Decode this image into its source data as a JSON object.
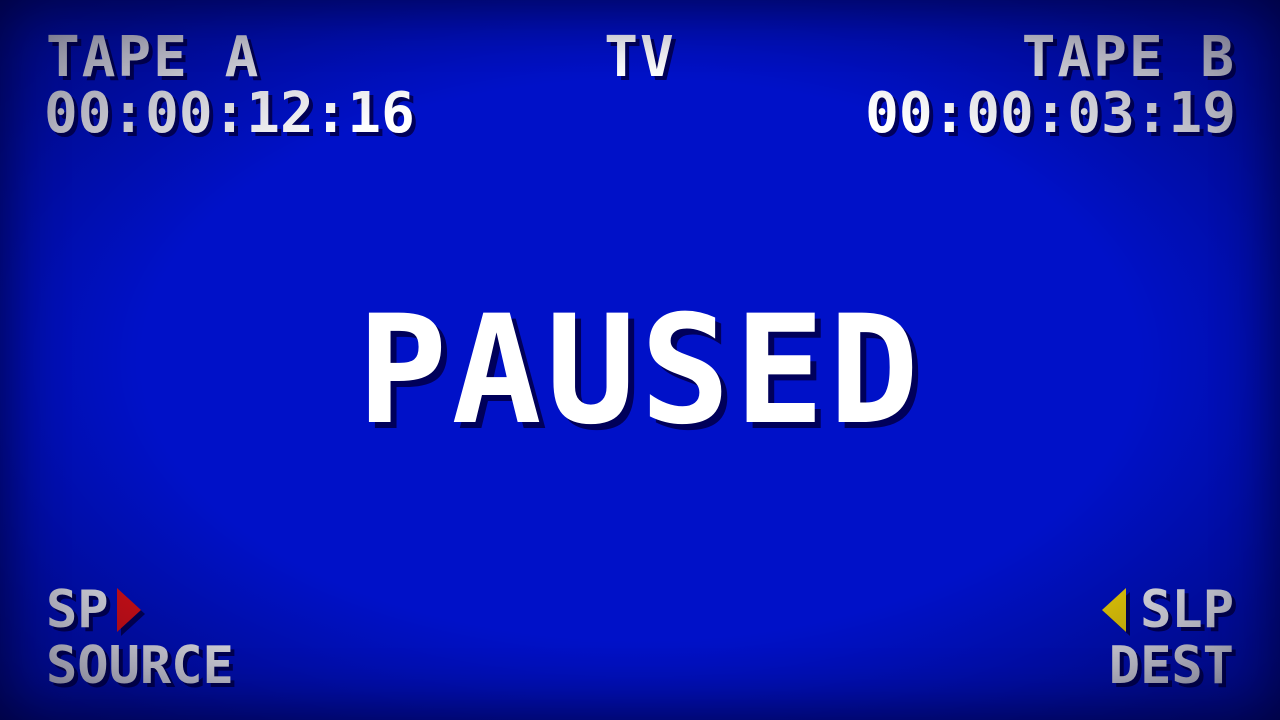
{
  "colors": {
    "background": "#0011c8",
    "text": "#ffffff",
    "source_indicator": "#ee1111",
    "dest_indicator": "#ffe000"
  },
  "tape_a": {
    "label": "TAPE A",
    "timecode": "00:00:12:16"
  },
  "center": {
    "label": "TV"
  },
  "tape_b": {
    "label": "TAPE B",
    "timecode": "00:00:03:19"
  },
  "status": {
    "text": "PAUSED"
  },
  "source": {
    "speed": "SP",
    "label": "SOURCE",
    "indicator_icon": "play-right-triangle-icon"
  },
  "dest": {
    "speed": "SLP",
    "label": "DEST",
    "indicator_icon": "play-left-triangle-icon"
  }
}
